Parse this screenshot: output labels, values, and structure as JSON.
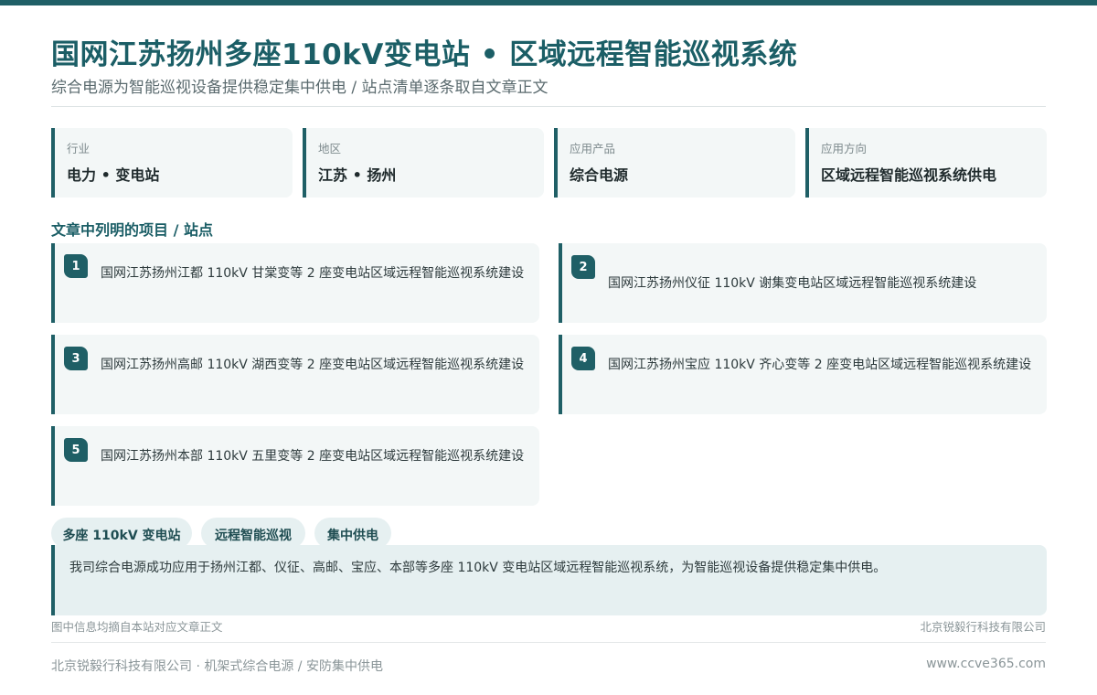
{
  "header": {
    "title": "国网江苏扬州多座110kV变电站 • 区域远程智能巡视系统",
    "subtitle": "综合电源为智能巡视设备提供稳定集中供电 / 站点清单逐条取自文章正文"
  },
  "info_cards": [
    {
      "label": "行业",
      "value": "电力 • 变电站"
    },
    {
      "label": "地区",
      "value": "江苏 • 扬州"
    },
    {
      "label": "应用产品",
      "value": "综合电源"
    },
    {
      "label": "应用方向",
      "value": "区域远程智能巡视系统供电"
    }
  ],
  "projects": {
    "title": "文章中列明的项目 / 站点",
    "items": [
      {
        "number": "1",
        "text": "国网江苏扬州江都 110kV 甘棠变等 2 座变电站区域远程智能巡视系统建设"
      },
      {
        "number": "2",
        "text": "国网江苏扬州仪征 110kV 谢集变电站区域远程智能巡视系统建设"
      },
      {
        "number": "3",
        "text": "国网江苏扬州高邮 110kV 湖西变等 2 座变电站区域远程智能巡视系统建设"
      },
      {
        "number": "4",
        "text": "国网江苏扬州宝应 110kV 齐心变等 2 座变电站区域远程智能巡视系统建设"
      },
      {
        "number": "5",
        "text": "国网江苏扬州本部 110kV 五里变等 2 座变电站区域远程智能巡视系统建设"
      }
    ]
  },
  "tags": [
    "多座 110kV 变电站",
    "远程智能巡视",
    "集中供电"
  ],
  "summary": "我司综合电源成功应用于扬州江都、仪征、高邮、宝应、本部等多座 110kV 变电站区域远程智能巡视系统，为智能巡视设备提供稳定集中供电。",
  "notes": {
    "left": "图中信息均摘自本站对应文章正文",
    "right": "北京锐毅行科技有限公司"
  },
  "footer": {
    "left": "北京锐毅行科技有限公司 · 机架式综合电源 / 安防集中供电",
    "right": "www.ccve365.com"
  },
  "colors": {
    "accent": "#1f5f66",
    "card_bg": "#f3f7f7",
    "tag_bg": "#e6f0f1"
  }
}
